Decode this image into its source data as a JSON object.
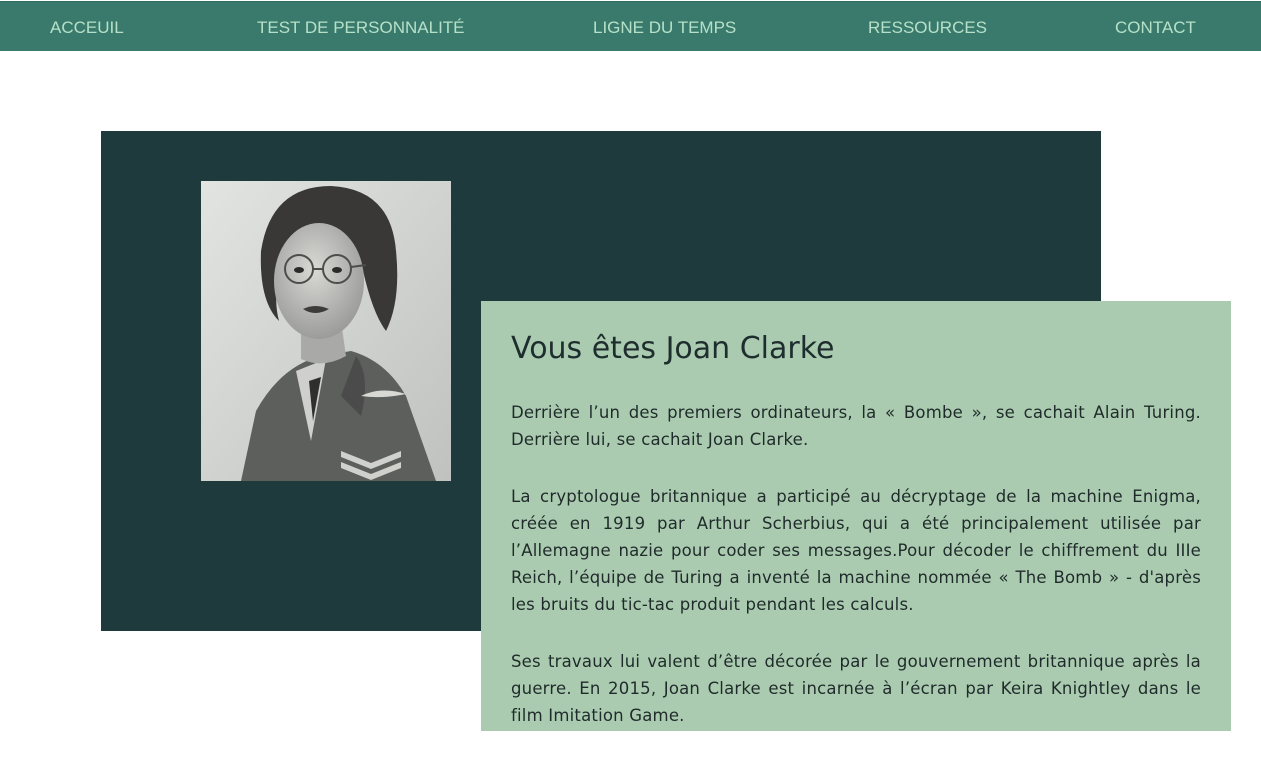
{
  "nav": {
    "items": [
      {
        "label": "ACCEUIL"
      },
      {
        "label": "TEST DE PERSONNALITÉ"
      },
      {
        "label": "LIGNE DU TEMPS"
      },
      {
        "label": "RESSOURCES"
      },
      {
        "label": "CONTACT"
      }
    ]
  },
  "colors": {
    "nav_background": "#3a7a6c",
    "nav_text": "#b6e0c8",
    "dark_panel": "#1f3a3d",
    "card_background": "#abcbb0",
    "text": "#1f2b2b"
  },
  "hero": {
    "portrait_icon": "portrait-photo",
    "title": "Vous êtes Joan Clarke",
    "paragraphs": [
      "Derrière l’un des premiers ordinateurs, la « Bombe », se cachait Alain Turing. Derrière lui, se cachait Joan Clarke.",
      "La cryptologue britannique a participé au décryptage de la machine Enigma, créée en 1919 par Arthur Scherbius, qui a été principalement utilisée par l’Allemagne nazie pour coder ses messages.Pour décoder le chiffrement du IIIe Reich, l’équipe de Turing a inventé la machine nommée « The Bomb » - d'après les bruits du tic-tac produit pendant les calculs.",
      "Ses travaux lui valent d’être décorée par le gouvernement britannique après la guerre. En 2015, Joan Clarke est incarnée à l’écran par Keira Knightley dans le film Imitation Game."
    ]
  }
}
